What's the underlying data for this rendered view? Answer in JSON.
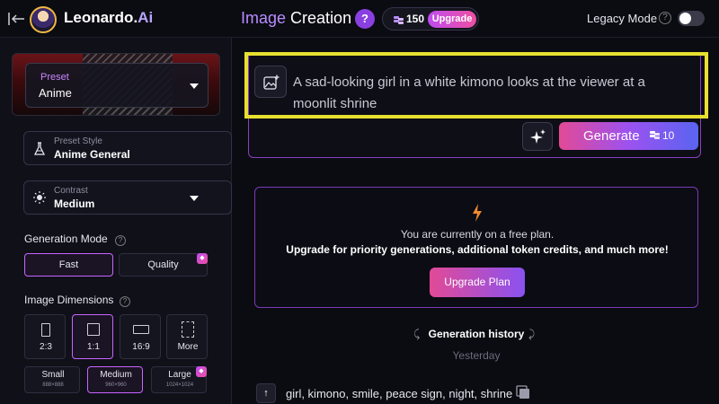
{
  "header": {
    "brand_main": "Leonardo.",
    "brand_ai": "Ai",
    "title_part1": "Image",
    "title_part2": "Creation",
    "help_label": "?",
    "token_count": "150",
    "upgrade_label": "Upgrade",
    "legacy_mode_label": "Legacy Mode",
    "legacy_mode_enabled": false
  },
  "sidebar": {
    "preset": {
      "tag": "Preset",
      "value": "Anime"
    },
    "preset_style": {
      "label": "Preset Style",
      "value": "Anime General"
    },
    "contrast": {
      "label": "Contrast",
      "value": "Medium"
    },
    "generation_mode": {
      "label": "Generation Mode",
      "options": [
        {
          "label": "Fast",
          "selected": true
        },
        {
          "label": "Quality",
          "selected": false,
          "premium": true
        }
      ]
    },
    "image_dimensions": {
      "label": "Image Dimensions",
      "ratios": [
        {
          "label": "2:3",
          "selected": false
        },
        {
          "label": "1:1",
          "selected": true
        },
        {
          "label": "16:9",
          "selected": false
        },
        {
          "label": "More",
          "selected": false
        }
      ],
      "sizes": [
        {
          "name": "Small",
          "dims": "888×888",
          "selected": false
        },
        {
          "name": "Medium",
          "dims": "960×960",
          "selected": true
        },
        {
          "name": "Large",
          "dims": "1024×1024",
          "selected": false,
          "premium": true
        }
      ]
    }
  },
  "prompt": {
    "text": "A sad-looking girl in a white kimono looks at the viewer at a moonlit shrine"
  },
  "generate": {
    "label": "Generate",
    "cost": "10"
  },
  "upgrade_panel": {
    "free_plan_text": "You are currently on a free plan.",
    "upsell_text": "Upgrade for priority generations, additional token credits, and much more!",
    "button_label": "Upgrade Plan"
  },
  "history": {
    "title": "Generation history",
    "date": "Yesterday",
    "entries": [
      {
        "prompt": "girl, kimono, smile, peace sign, night, shrine"
      }
    ]
  },
  "colors": {
    "accent_purple": "#c864ff",
    "gradient_pink": "#e24a96",
    "gradient_blue": "#5a64f0",
    "highlight_yellow": "#e8e030",
    "background": "#0b0b12"
  },
  "icons": {
    "back": "back-arrow-icon",
    "token": "token-coins-icon",
    "image_upload": "image-upload-icon",
    "sparkle": "sparkle-icon",
    "bolt": "lightning-bolt-icon",
    "copy": "copy-icon"
  }
}
